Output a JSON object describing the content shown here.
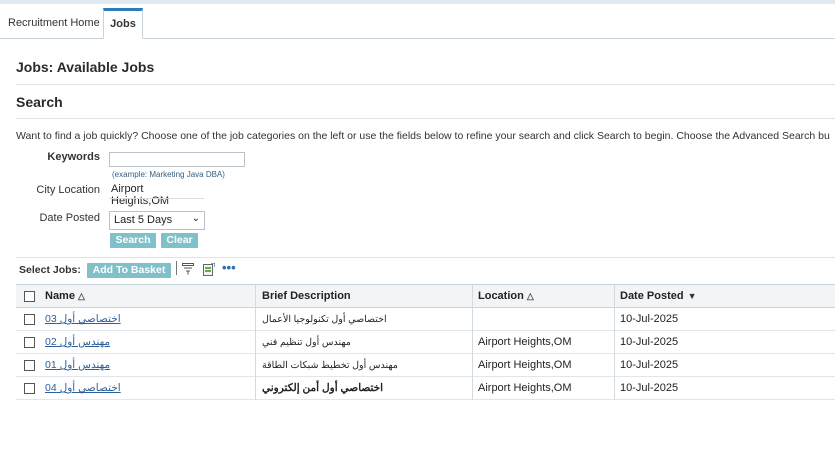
{
  "tabs": [
    {
      "label": "Recruitment Home"
    },
    {
      "label": "Jobs"
    }
  ],
  "page_title": "Jobs: Available Jobs",
  "search": {
    "section_title": "Search",
    "instructions": "Want to find a job quickly? Choose one of the job categories on the left or use the fields below to refine your search and click Search to begin. Choose the Advanced Search bu",
    "keywords_label": "Keywords",
    "keywords_value": "",
    "keywords_hint": "(example: Marketing Java DBA)",
    "city_label": "City Location",
    "city_value": "Airport Heights,OM",
    "date_label": "Date Posted",
    "date_value": "Last 5 Days",
    "search_button": "Search",
    "clear_button": "Clear"
  },
  "results": {
    "select_label": "Select Jobs:",
    "add_to_basket": "Add To Basket",
    "icons": [
      "filter-icon",
      "export-icon",
      "more-icon"
    ],
    "more_label": "•••",
    "columns": [
      "Name",
      "Brief Description",
      "Location",
      "Date Posted"
    ],
    "sort": {
      "name": "up",
      "location": "up",
      "date_posted": "down"
    },
    "sort_up_glyph": "△",
    "sort_down_glyph": "▼",
    "rows": [
      {
        "name": "اختصاصي أول 03",
        "description": "اختصاصي أول تكنولوجيا الأعمال",
        "location": "",
        "date_posted": "10-Jul-2025",
        "bold": false
      },
      {
        "name": "مهندس أول 02",
        "description": "مهندس أول تنظيم فني",
        "location": "Airport Heights,OM",
        "date_posted": "10-Jul-2025",
        "bold": false
      },
      {
        "name": "مهندس أول 01",
        "description": "مهندس أول تخطيط شبكات الطاقة",
        "location": "Airport Heights,OM",
        "date_posted": "10-Jul-2025",
        "bold": false
      },
      {
        "name": "اختصاصي أول 04",
        "description": "اختصاصي أول أمن إلكتروني",
        "location": "Airport Heights,OM",
        "date_posted": "10-Jul-2025",
        "bold": true
      }
    ]
  },
  "colors": {
    "accent_tab": "#2d7dbd",
    "button_bg": "#7fc0c9",
    "link": "#2b5f9a"
  }
}
